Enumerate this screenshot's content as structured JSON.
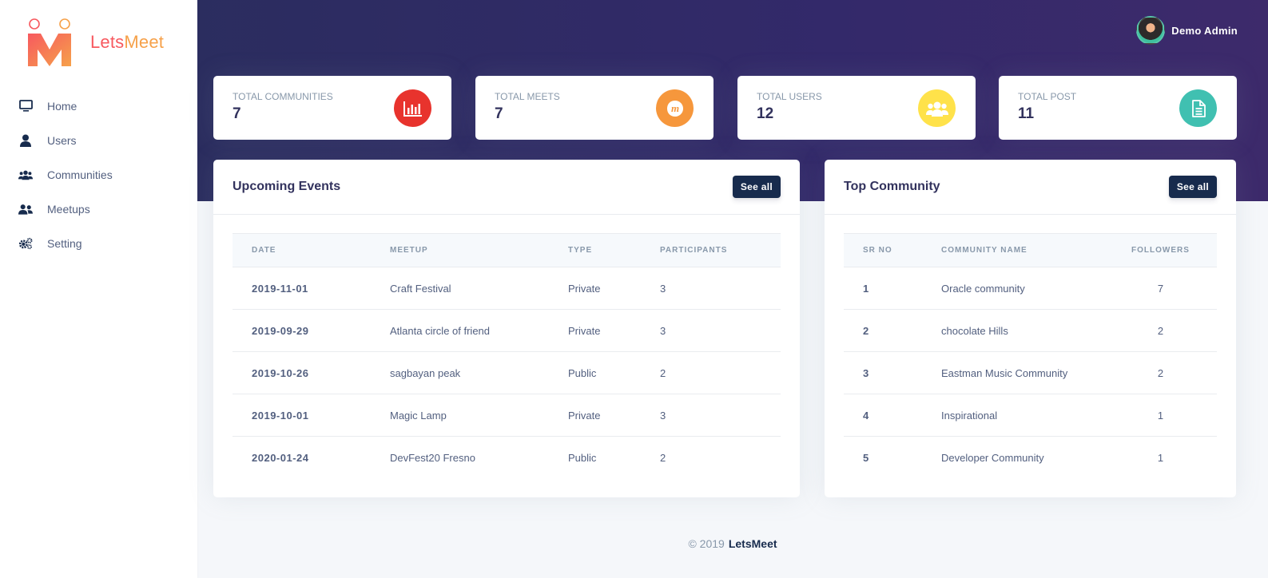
{
  "brand": {
    "part1": "Lets",
    "part2": "Meet"
  },
  "sidebar": {
    "items": [
      {
        "label": "Home",
        "icon": "monitor-icon"
      },
      {
        "label": "Users",
        "icon": "user-icon"
      },
      {
        "label": "Communities",
        "icon": "users-group-icon"
      },
      {
        "label": "Meetups",
        "icon": "user-friends-icon"
      },
      {
        "label": "Setting",
        "icon": "cogs-icon"
      }
    ]
  },
  "header": {
    "user_name": "Demo Admin"
  },
  "stats": [
    {
      "title": "TOTAL COMMUNITIES",
      "value": "7",
      "icon": "chart-bar-icon",
      "color": "#e8332d"
    },
    {
      "title": "TOTAL MEETS",
      "value": "7",
      "icon": "meetup-icon",
      "color": "#f6973c"
    },
    {
      "title": "TOTAL USERS",
      "value": "12",
      "icon": "users-icon",
      "color": "#ffe24a"
    },
    {
      "title": "TOTAL POST",
      "value": "11",
      "icon": "file-alt-icon",
      "color": "#40c0b1"
    }
  ],
  "events": {
    "title": "Upcoming Events",
    "see_all": "See all",
    "columns": [
      "DATE",
      "MEETUP",
      "TYPE",
      "PARTICIPANTS"
    ],
    "rows": [
      [
        "2019-11-01",
        "Craft Festival",
        "Private",
        "3"
      ],
      [
        "2019-09-29",
        "Atlanta circle of friend",
        "Private",
        "3"
      ],
      [
        "2019-10-26",
        "sagbayan peak",
        "Public",
        "2"
      ],
      [
        "2019-10-01",
        "Magic Lamp",
        "Private",
        "3"
      ],
      [
        "2020-01-24",
        "DevFest20 Fresno",
        "Public",
        "2"
      ]
    ]
  },
  "community": {
    "title": "Top Community",
    "see_all": "See all",
    "columns": [
      "SR NO",
      "COMMUNITY NAME",
      "FOLLOWERS"
    ],
    "rows": [
      [
        "1",
        "Oracle community",
        "7"
      ],
      [
        "2",
        "chocolate Hills",
        "2"
      ],
      [
        "3",
        "Eastman Music Community",
        "2"
      ],
      [
        "4",
        "Inspirational",
        "1"
      ],
      [
        "5",
        "Developer Community",
        "1"
      ]
    ]
  },
  "footer": {
    "copyright": "© 2019",
    "brand": "LetsMeet"
  },
  "colors": {
    "header": "#2b2d5f",
    "button": "#172b4d",
    "brand_orange": "#f6a14a",
    "brand_red": "#f7595f"
  }
}
